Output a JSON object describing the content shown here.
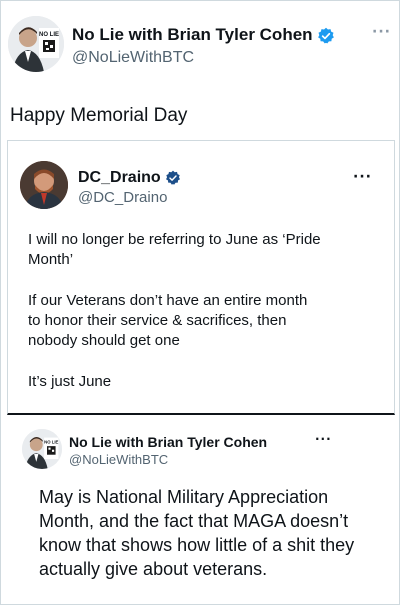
{
  "main_tweet": {
    "name": "No Lie with Brian Tyler Cohen",
    "handle": "@NoLieWithBTC",
    "text": "Happy Memorial Day",
    "avatar_badge": "NO LIE"
  },
  "quoted_tweet": {
    "name": "DC_Draino",
    "handle": "@DC_Draino",
    "lines": [
      "I will no longer be referring to June as ‘Pride",
      "Month’",
      "If our Veterans don’t have an entire month",
      "to honor their service & sacrifices, then",
      "nobody should get one",
      "It’s just June"
    ]
  },
  "reply_tweet": {
    "name": "No Lie with Brian Tyler Cohen",
    "handle": "@NoLieWithBTC",
    "avatar_badge": "NO LIE",
    "lines": [
      "May is National Military Appreciation",
      "Month, and the fact that MAGA doesn’t",
      "know that shows how little of a shit they",
      "actually give about veterans."
    ]
  },
  "menu_icon": "more-horizontal-icon",
  "verified_color": "#1d9bf0"
}
